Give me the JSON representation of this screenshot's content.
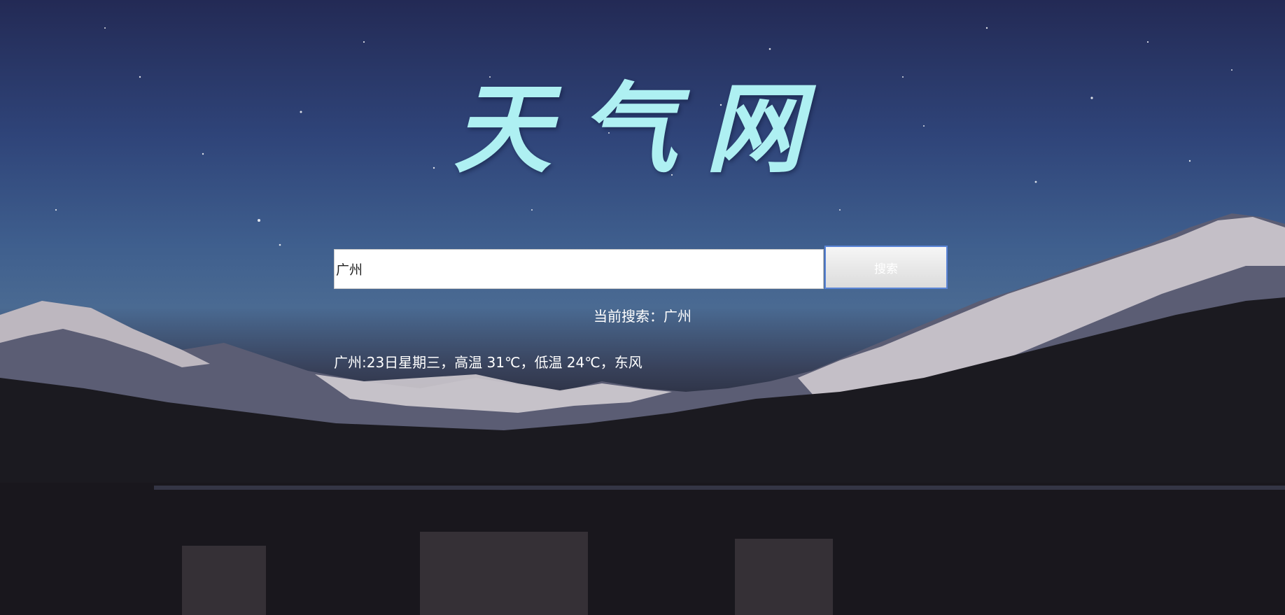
{
  "header": {
    "title": "天气网"
  },
  "search": {
    "value": "广州",
    "placeholder": "",
    "button_label": "搜索"
  },
  "status": {
    "current_search_text": "当前搜索：广州"
  },
  "result": {
    "weather_text": "广州:23日星期三，高温 31℃，低温 24℃，东风"
  },
  "colors": {
    "title": "#aef0f2",
    "button_border": "#5a84d6",
    "text": "#ffffff"
  }
}
